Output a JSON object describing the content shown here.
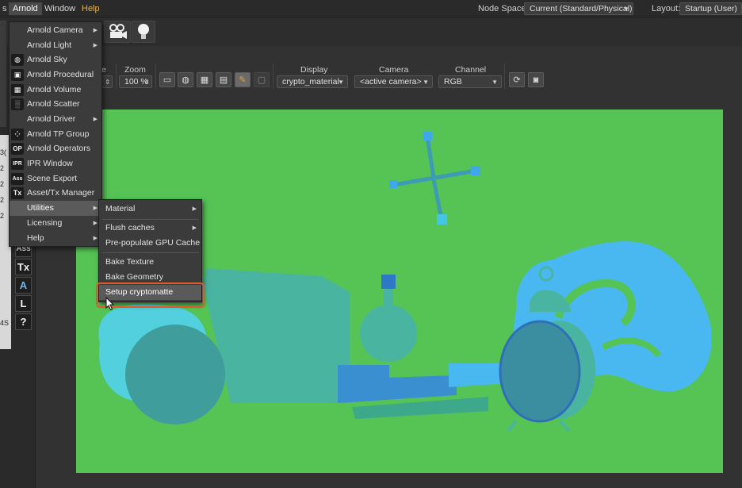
{
  "menubar": {
    "items": [
      {
        "label": "s"
      },
      {
        "label": "Arnold"
      },
      {
        "label": "Window"
      },
      {
        "label": "Help"
      }
    ],
    "node_space_label": "Node Space:",
    "node_space_value": "Current (Standard/Physical)",
    "layout_label": "Layout:",
    "layout_value": "Startup (User)"
  },
  "ipr_toolbar": {
    "truncated_label": "e",
    "zoom_label": "Zoom",
    "zoom_value": "100 %",
    "display_label": "Display",
    "display_value": "crypto_material",
    "camera_label": "Camera",
    "camera_value": "<active camera>",
    "channel_label": "Channel",
    "channel_value": "RGB"
  },
  "palette": {
    "buttons": [
      "Ass",
      "Tx",
      "A",
      "L",
      "?"
    ]
  },
  "left_strip_text": [
    "3(",
    "2",
    "2",
    "2",
    "2",
    "4S"
  ],
  "arnold_menu": {
    "items": [
      {
        "label": "Arnold Camera",
        "icon": "camera-icon",
        "glyph": "",
        "submenu": true
      },
      {
        "label": "Arnold Light",
        "icon": "light-icon",
        "glyph": "",
        "submenu": true
      },
      {
        "label": "Arnold Sky",
        "icon": "sky-sphere-icon",
        "glyph": "◍",
        "submenu": false
      },
      {
        "label": "Arnold Procedural",
        "icon": "procedural-icon",
        "glyph": "▣",
        "submenu": false
      },
      {
        "label": "Arnold Volume",
        "icon": "volume-icon",
        "glyph": "▦",
        "submenu": false
      },
      {
        "label": "Arnold Scatter",
        "icon": "scatter-icon",
        "glyph": "░",
        "submenu": false
      },
      {
        "label": "Arnold Driver",
        "icon": "driver-icon",
        "glyph": "",
        "submenu": true
      },
      {
        "label": "Arnold TP Group",
        "icon": "tp-group-icon",
        "glyph": "⁘",
        "submenu": false
      },
      {
        "label": "Arnold Operators",
        "icon": "operators-icon",
        "glyph": "OP",
        "submenu": false
      },
      {
        "label": "IPR Window",
        "icon": "ipr-icon",
        "glyph": "IPR",
        "submenu": false
      },
      {
        "label": "Scene Export",
        "icon": "ass-export-icon",
        "glyph": "Ass",
        "submenu": false
      },
      {
        "label": "Asset/Tx Manager",
        "icon": "tx-manager-icon",
        "glyph": "Tx",
        "submenu": false
      },
      {
        "label": "Utilities",
        "icon": "",
        "glyph": "",
        "submenu": true
      },
      {
        "label": "Licensing",
        "icon": "",
        "glyph": "",
        "submenu": true
      },
      {
        "label": "Help",
        "icon": "",
        "glyph": "",
        "submenu": true
      }
    ]
  },
  "utilities_menu": {
    "items": [
      {
        "label": "Material",
        "submenu": true
      },
      {
        "label": "Flush caches",
        "submenu": true
      },
      {
        "label": "Pre-populate GPU Cache",
        "submenu": false
      },
      {
        "label": "Bake Texture",
        "submenu": false
      },
      {
        "label": "Bake Geometry",
        "submenu": false
      },
      {
        "label": "Setup cryptomatte",
        "submenu": false
      }
    ]
  },
  "colors": {
    "viewport_bg": "#55c455",
    "highlight_ring": "#e05a2b",
    "help_menu": "#e8b04a"
  }
}
